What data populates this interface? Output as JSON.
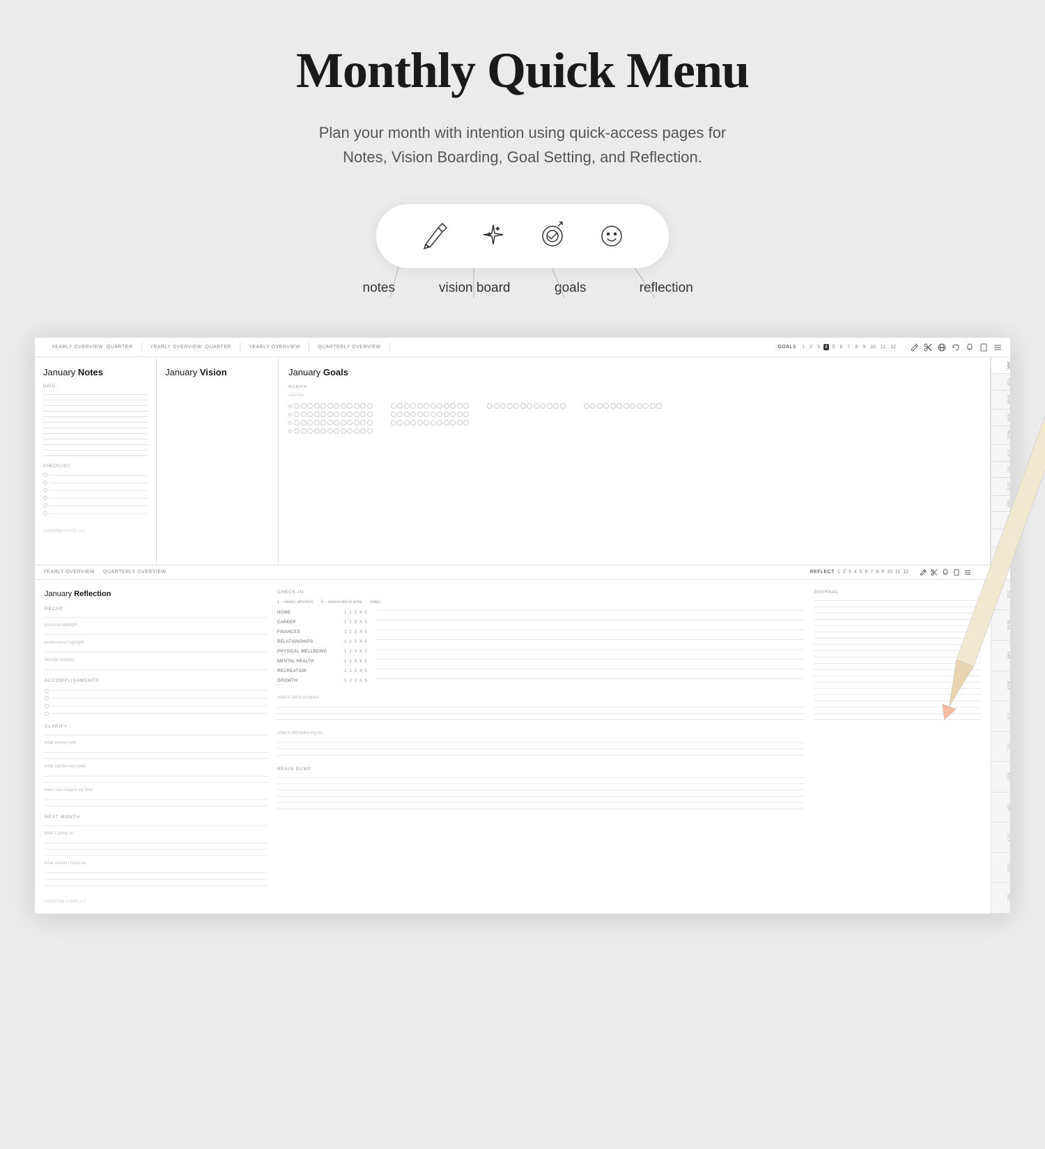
{
  "hero": {
    "title": "Monthly Quick Menu",
    "subtitle": "Plan your month with intention using quick-access pages for\nNotes, Vision Boarding, Goal Setting, and Reflection."
  },
  "icons": [
    {
      "id": "notes",
      "label": "notes",
      "type": "pen"
    },
    {
      "id": "vision-board",
      "label": "vision board",
      "type": "sparkle"
    },
    {
      "id": "goals",
      "label": "goals",
      "type": "target"
    },
    {
      "id": "reflection",
      "label": "reflection",
      "type": "smiley"
    }
  ],
  "planner": {
    "nav_tabs": [
      {
        "label": "YEARLY OVERVIEW",
        "sub": "QUARTER"
      },
      {
        "label": "YEARLY OVERVIEW",
        "sub": "QUARTER"
      },
      {
        "label": "YEARLY OVERVIEW",
        "sub": ""
      },
      {
        "label": "QUARTERLY OVERVIEW",
        "sub": ""
      }
    ],
    "goals_label": "GOALS",
    "goals_numbers": [
      "1",
      "2",
      "3",
      "4",
      "5",
      "6",
      "7",
      "8",
      "9",
      "10",
      "11",
      "12"
    ],
    "panels": {
      "notes": {
        "title": "January ",
        "title_bold": "Notes",
        "date_label": "DATE:",
        "checklist_label": "CHECKLIST:",
        "line_count": 12,
        "check_count": 6,
        "watermark": "© KRISTINA STUDIO, LLC"
      },
      "vision": {
        "title": "January ",
        "title_bold": "Vision"
      },
      "goals": {
        "title": "January ",
        "title_bold": "Goals",
        "habits_label": "HABITS",
        "color_key": "color key",
        "habit_rows": 4,
        "dots_per_row": 12
      }
    },
    "months": [
      "JAN",
      "FEB",
      "MAR",
      "APR",
      "MAY",
      "JUN",
      "JUL",
      "AUG",
      "SEP",
      "OCT",
      "NOV",
      "DEC"
    ],
    "months_right": [
      "FEB",
      "MAR",
      "APR",
      "MAY",
      "JUN",
      "JUL",
      "AUG",
      "SEP",
      "OCT",
      "NOV",
      "DEC"
    ],
    "reflection": {
      "title": "January ",
      "title_bold": "Reflection",
      "nav_tabs": [
        "YEARLY OVERVIEW",
        "QUARTERLY OVERVIEW"
      ],
      "reflect_label": "REFLECT",
      "numbers": [
        "1",
        "2",
        "3",
        "4",
        "5",
        "6",
        "7",
        "8",
        "9",
        "10",
        "11",
        "12"
      ],
      "recap": {
        "heading": "RECAP",
        "fields": [
          "personal highlight",
          "professional highlight",
          "favorite memory"
        ]
      },
      "accomplishments": {
        "heading": "ACCOMPLISHMENTS",
        "count": 4
      },
      "clarify": {
        "heading": "CLARIFY",
        "fields": [
          "what worked well",
          "what can be improved",
          "how i can respect my time"
        ]
      },
      "next_month": {
        "heading": "NEXT MONTH",
        "fields": [
          "what's going on",
          "what should i focus on"
        ]
      },
      "checkin": {
        "heading": "CHECK-IN",
        "scale_low": "1 – needs attention",
        "scale_high": "5 – successful in area",
        "notes_label": "notes",
        "categories": [
          "HOME",
          "CAREER",
          "FINANCES",
          "RELATIONSHIPS",
          "PHYSICAL WELLBEING",
          "MENTAL HEALTH",
          "RECREATION",
          "GROWTH"
        ],
        "scale": [
          "1",
          "2",
          "3",
          "4",
          "5"
        ],
        "in_progress": "what is still in progress",
        "bothering": "what is still bothering me"
      },
      "journal": {
        "heading": "JOURNAL"
      },
      "brain_dump": {
        "heading": "BRAIN DUMP"
      },
      "watermark": "© KRISTINA STUDIO, LLC"
    }
  }
}
